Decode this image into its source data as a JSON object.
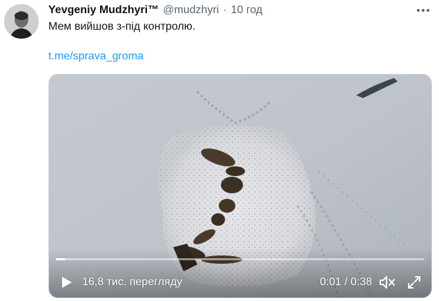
{
  "tweet": {
    "author_name": "Yevgeniy Mudzhyri™",
    "author_handle": "@mudzhyri",
    "separator": "·",
    "time": "10 год",
    "text": "Мем вийшов з-під контролю.",
    "link": "t.me/sprava_groma",
    "more_icon": "more-dots-icon",
    "avatar_icon": "avatar-photo"
  },
  "video": {
    "views": "16,8 тис. перегляду",
    "current_time": "0:01",
    "time_separator": " / ",
    "duration": "0:38",
    "progress": 0.026,
    "play_icon": "play-icon",
    "mute_icon": "volume-muted-icon",
    "fullscreen_icon": "fullscreen-icon"
  },
  "colors": {
    "link": "#1d9bf0",
    "secondary_text": "#536471",
    "primary_text": "#0f1419"
  }
}
